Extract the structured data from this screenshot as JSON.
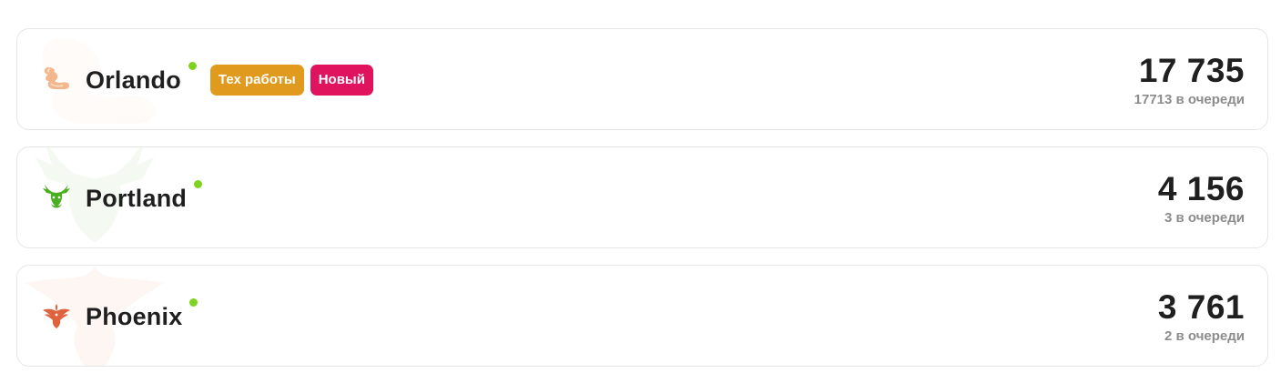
{
  "servers": [
    {
      "name": "Orlando",
      "icon": "swan-icon",
      "icon_color": "#f4b68c",
      "status_color": "#7ed321",
      "badges": [
        {
          "label": "Тех работы",
          "color": "#e09b1f"
        },
        {
          "label": "Новый",
          "color": "#e0135f"
        }
      ],
      "online": "17 735",
      "queue": "17713 в очереди"
    },
    {
      "name": "Portland",
      "icon": "deer-icon",
      "icon_color": "#4caf22",
      "status_color": "#7ed321",
      "badges": [],
      "online": "4 156",
      "queue": "3 в очереди"
    },
    {
      "name": "Phoenix",
      "icon": "phoenix-icon",
      "icon_color": "#e0633f",
      "status_color": "#7ed321",
      "badges": [],
      "online": "3 761",
      "queue": "2 в очереди"
    }
  ]
}
